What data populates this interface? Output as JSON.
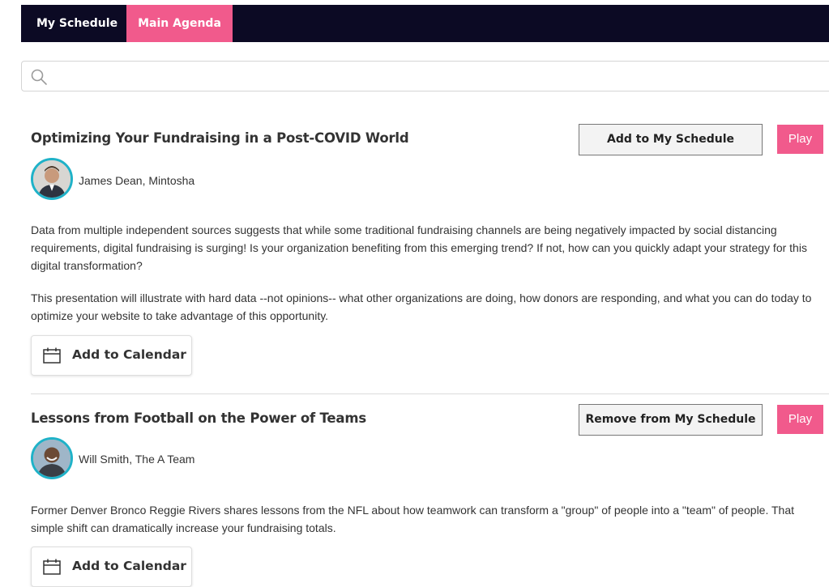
{
  "nav": {
    "tabs": [
      {
        "label": "My Schedule"
      },
      {
        "label": "Main Agenda"
      }
    ],
    "active_color": "#f15a8c",
    "bar_color": "#0c0a24"
  },
  "search": {
    "placeholder": "",
    "value": ""
  },
  "sessions": [
    {
      "title": "Optimizing Your Fundraising in a Post-COVID World",
      "schedule_button": "Add to My Schedule",
      "play_button": "Play",
      "speaker": "James Dean, Mintosha",
      "paragraphs": [
        "Data from multiple independent sources suggests that while some traditional fundraising channels are being negatively impacted by social distancing requirements, digital fundraising is surging!  Is your organization benefiting from this emerging trend?  If not, how can you quickly adapt your strategy for this digital transformation?",
        "This presentation will illustrate with hard data --not opinions-- what other organizations are doing, how donors are responding, and what you can do today to optimize your website to take advantage of this opportunity."
      ],
      "calendar_button": "Add to Calendar"
    },
    {
      "title": "Lessons from Football on the Power of Teams",
      "schedule_button": "Remove from My Schedule",
      "play_button": "Play",
      "speaker": "Will Smith, The A Team",
      "paragraphs": [
        "Former Denver Bronco Reggie Rivers shares lessons from the NFL about how teamwork can transform a \"group\" of people into a \"team\" of people. That simple shift can dramatically increase your fundraising totals."
      ],
      "calendar_button": "Add to Calendar"
    }
  ],
  "icons": {
    "search": "search-icon",
    "calendar": "calendar-icon",
    "avatar": "avatar"
  }
}
